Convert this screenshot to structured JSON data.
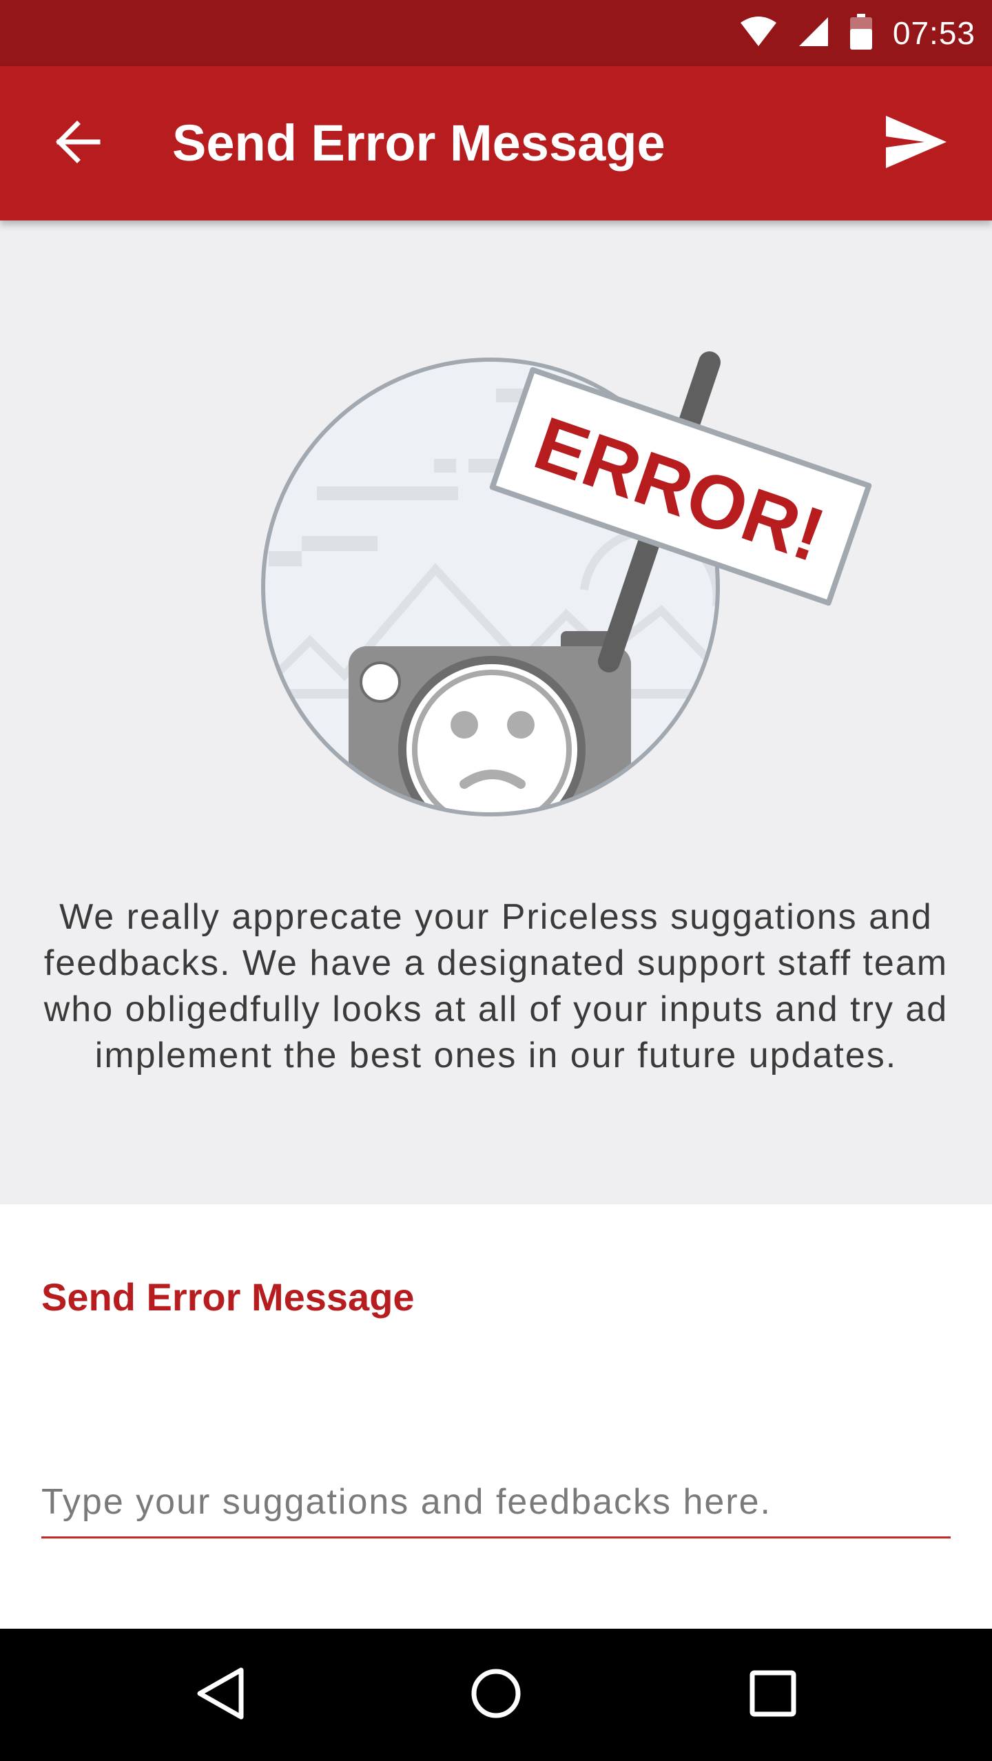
{
  "status_bar": {
    "time": "07:53",
    "icons": [
      "wifi-icon",
      "signal-icon",
      "battery-icon"
    ]
  },
  "app_bar": {
    "title": "Send Error Message",
    "back_icon": "arrow-back-icon",
    "send_icon": "send-icon"
  },
  "illustration": {
    "sign_text": "ERROR!"
  },
  "description": "We really apprecate your Priceless suggations and feedbacks. We have a designated support staff team who obligedfully looks at all of your inputs  and try ad implement the best ones in our future updates.",
  "form": {
    "label": "Send Error Message",
    "value": "",
    "placeholder": "Type your suggations and feedbacks here."
  },
  "nav_bar": {
    "icons": [
      "back-triangle-icon",
      "home-circle-icon",
      "recents-square-icon"
    ]
  },
  "colors": {
    "primary": "#b71c1f",
    "primary_dark": "#951618",
    "background": "#efeff1",
    "card": "#ffffff",
    "text": "#3a3a3a"
  }
}
